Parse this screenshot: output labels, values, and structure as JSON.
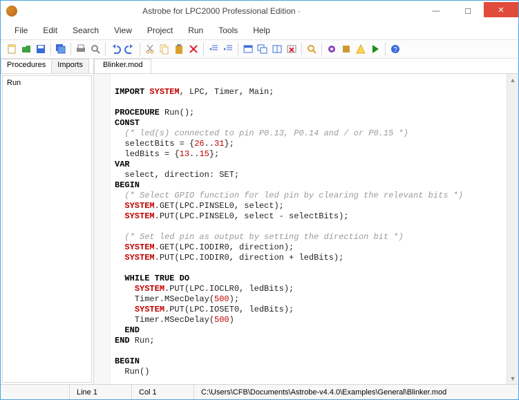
{
  "window": {
    "title": "Astrobe for LPC2000 Professional Edition  ·"
  },
  "menus": {
    "file": "File",
    "edit": "Edit",
    "search": "Search",
    "view": "View",
    "project": "Project",
    "run": "Run",
    "tools": "Tools",
    "help": "Help"
  },
  "side": {
    "tab_procedures": "Procedures",
    "tab_imports": "Imports",
    "item0": "Run"
  },
  "editor": {
    "tab0": "Blinker.mod"
  },
  "code": {
    "l1a": "IMPORT ",
    "l1b": "SYSTEM",
    "l1c": ", LPC, Timer, Main;",
    "l2a": "PROCEDURE",
    "l2b": " Run();",
    "l3": "CONST",
    "l4": "  (* led(s) connected to pin P0.13, P0.14 and / or P0.15 *)",
    "l5a": "  selectBits = {",
    "l5b": "26",
    "l5c": "..",
    "l5d": "31",
    "l5e": "};",
    "l6a": "  ledBits = {",
    "l6b": "13",
    "l6c": "..",
    "l6d": "15",
    "l6e": "};",
    "l7": "VAR",
    "l8": "  select, direction: SET;",
    "l9": "BEGIN",
    "l10": "  (* Select GPIO function for led pin by clearing the relevant bits *)",
    "l11a": "  ",
    "l11b": "SYSTEM",
    "l11c": ".GET(LPC.PINSEL0, select);",
    "l12a": "  ",
    "l12b": "SYSTEM",
    "l12c": ".PUT(LPC.PINSEL0, select - selectBits);",
    "l13": "  (* Set led pin as output by setting the direction bit *)",
    "l14a": "  ",
    "l14b": "SYSTEM",
    "l14c": ".GET(LPC.IODIR0, direction);",
    "l15a": "  ",
    "l15b": "SYSTEM",
    "l15c": ".PUT(LPC.IODIR0, direction + ledBits);",
    "l16a": "  ",
    "l16b": "WHILE",
    "l16c": " ",
    "l16d": "TRUE",
    "l16e": " ",
    "l16f": "DO",
    "l17a": "    ",
    "l17b": "SYSTEM",
    "l17c": ".PUT(LPC.IOCLR0, ledBits);",
    "l18a": "    Timer.MSecDelay(",
    "l18b": "500",
    "l18c": ");",
    "l19a": "    ",
    "l19b": "SYSTEM",
    "l19c": ".PUT(LPC.IOSET0, ledBits);",
    "l20a": "    Timer.MSecDelay(",
    "l20b": "500",
    "l20c": ")",
    "l21": "  END",
    "l22a": "END",
    "l22b": " Run;",
    "l23": "BEGIN",
    "l24": "  Run()"
  },
  "status": {
    "line": "Line 1",
    "col": "Col 1",
    "path": "C:\\Users\\CFB\\Documents\\Astrobe-v4.4.0\\Examples\\General\\Blinker.mod"
  },
  "icons": {
    "new": "#f4d36b",
    "open": "#3fa03f",
    "save": "#3a6bd8",
    "print": "#888",
    "preview": "#999",
    "undo": "#3a6bd8",
    "redo": "#3a6bd8",
    "cut": "#cc9933",
    "copy": "#e0b34c",
    "paste": "#e0a030",
    "delete": "#d23",
    "indentL": "#3a6bd8",
    "indentR": "#3a6bd8",
    "win1": "#3a6bd8",
    "win2": "#3a6bd8",
    "win3": "#3a6bd8",
    "winx": "#d23",
    "find": "#e0a030",
    "gear": "#8b3fbf",
    "build": "#cc9933",
    "warn": "#e0a030",
    "play": "#1a8d1a",
    "help": "#3a6bd8"
  }
}
